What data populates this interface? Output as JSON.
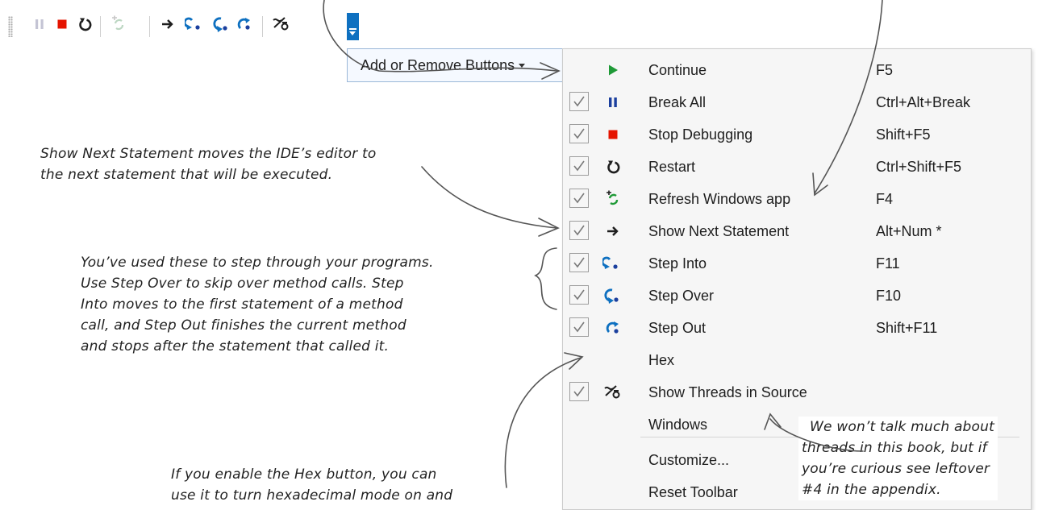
{
  "toolbar": {
    "buttons": [
      {
        "name": "break-all-button",
        "icon": "pause-icon",
        "enabled": false
      },
      {
        "name": "stop-debugging-button",
        "icon": "stop-icon"
      },
      {
        "name": "restart-button",
        "icon": "restart-icon"
      },
      {
        "name": "refresh-windows-app-button",
        "icon": "refresh-app-icon",
        "enabled": false
      },
      {
        "name": "show-next-statement-button",
        "icon": "arrow-right-icon"
      },
      {
        "name": "step-into-button",
        "icon": "step-into-icon"
      },
      {
        "name": "step-over-button",
        "icon": "step-over-icon"
      },
      {
        "name": "step-out-button",
        "icon": "step-out-icon"
      },
      {
        "name": "show-threads-button",
        "icon": "threads-icon"
      }
    ],
    "overflow_color": "#0e70c0"
  },
  "add_remove": {
    "label": "Add or Remove Buttons"
  },
  "menu": {
    "items": [
      {
        "label": "Continue",
        "shortcut": "F5",
        "checked": false,
        "icon": "play-icon"
      },
      {
        "label": "Break All",
        "shortcut": "Ctrl+Alt+Break",
        "checked": true,
        "icon": "pause-icon"
      },
      {
        "label": "Stop Debugging",
        "shortcut": "Shift+F5",
        "checked": true,
        "icon": "stop-icon"
      },
      {
        "label": "Restart",
        "shortcut": "Ctrl+Shift+F5",
        "checked": true,
        "icon": "restart-icon"
      },
      {
        "label": "Refresh Windows app",
        "shortcut": "F4",
        "checked": true,
        "icon": "refresh-app-icon"
      },
      {
        "label": "Show Next Statement",
        "shortcut": "Alt+Num *",
        "checked": true,
        "icon": "arrow-right-icon"
      },
      {
        "label": "Step Into",
        "shortcut": "F11",
        "checked": true,
        "icon": "step-into-icon"
      },
      {
        "label": "Step Over",
        "shortcut": "F10",
        "checked": true,
        "icon": "step-over-icon"
      },
      {
        "label": "Step Out",
        "shortcut": "Shift+F11",
        "checked": true,
        "icon": "step-out-icon"
      },
      {
        "label": "Hex",
        "shortcut": "",
        "checked": false,
        "icon": ""
      },
      {
        "label": "Show Threads in Source",
        "shortcut": "",
        "checked": true,
        "icon": "threads-icon"
      },
      {
        "label": "Windows",
        "shortcut": "",
        "checked": false,
        "icon": ""
      },
      {
        "label": "Customize...",
        "shortcut": "",
        "checked": false,
        "icon": ""
      },
      {
        "label": "Reset Toolbar",
        "shortcut": "",
        "checked": false,
        "icon": ""
      }
    ]
  },
  "annotations": {
    "next_statement": [
      "Show Next Statement moves the IDE’s editor to",
      "the next statement that will be executed."
    ],
    "stepping": [
      "You’ve used these to step through your programs.",
      "Use Step Over to skip over method calls. Step",
      "Into moves to the first statement of a method",
      "call, and Step Out finishes the current method",
      "and stops after the statement that called it."
    ],
    "threads": [
      "We won’t talk much about",
      "threads in this book, but if",
      "you’re curious see leftover",
      "#4 in the appendix."
    ],
    "hex": [
      "If you enable the Hex button, you can",
      "use it to turn hexadecimal mode on and"
    ]
  },
  "colors": {
    "green": "#1f9a37",
    "red": "#e51400",
    "blue": "#0e70c0",
    "dark_blue": "#1b3f9e"
  }
}
